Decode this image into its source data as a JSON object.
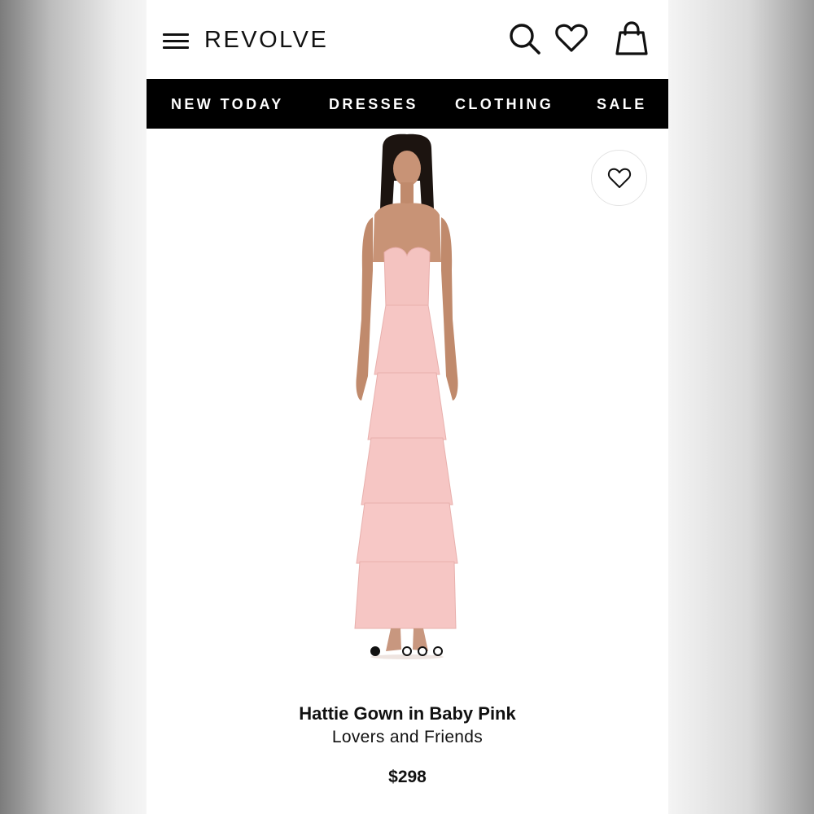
{
  "header": {
    "logo": "REVOLVE"
  },
  "nav": {
    "items": [
      {
        "label": "NEW TODAY"
      },
      {
        "label": "DRESSES"
      },
      {
        "label": "CLOTHING"
      },
      {
        "label": "SALE"
      }
    ]
  },
  "product": {
    "title": "Hattie Gown in Baby Pink",
    "brand": "Lovers and Friends",
    "price": "$298",
    "dress_color": "#f6c6c4",
    "image_count": 4,
    "active_image": 1
  },
  "icons": {
    "menu": "hamburger-menu-icon",
    "search": "search-icon",
    "wishlist": "heart-icon",
    "bag": "shopping-bag-icon",
    "favorite": "heart-outline-icon"
  },
  "colors": {
    "nav_background": "#000000",
    "text": "#111111",
    "background": "#ffffff"
  }
}
